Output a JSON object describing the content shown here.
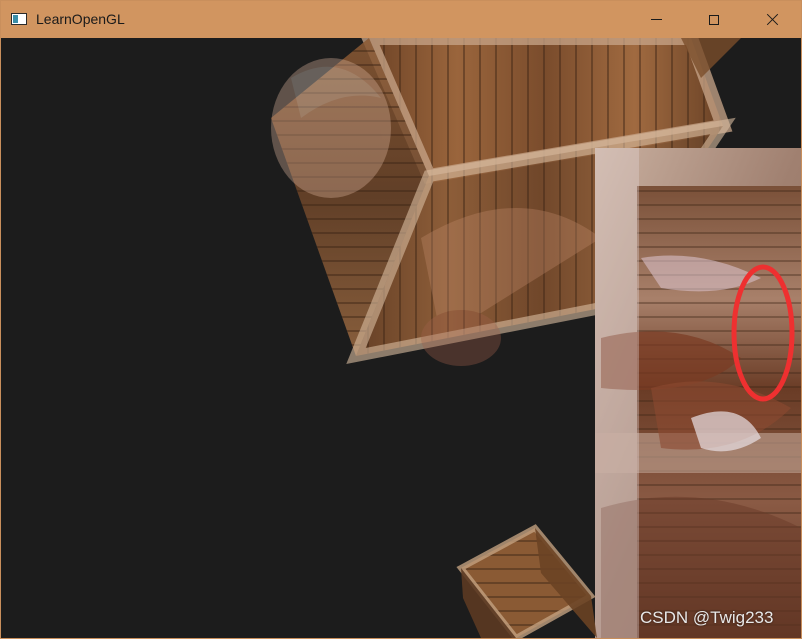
{
  "window": {
    "title": "LearnOpenGL",
    "controls": [
      "minimize",
      "maximize",
      "close"
    ]
  },
  "icons": {
    "app": "opengl-window-icon",
    "minimize": "minimize-icon",
    "maximize": "maximize-icon",
    "close": "close-icon"
  },
  "scene": {
    "background_color": "#1c1c1c",
    "objects": [
      "wooden-crate-top",
      "wooden-crate-large-foreground",
      "wooden-crate-small-bottom",
      "tree-trunk-texture-overlay"
    ],
    "highlight_color": "#ee3030"
  },
  "watermark": "CSDN @Twig233"
}
